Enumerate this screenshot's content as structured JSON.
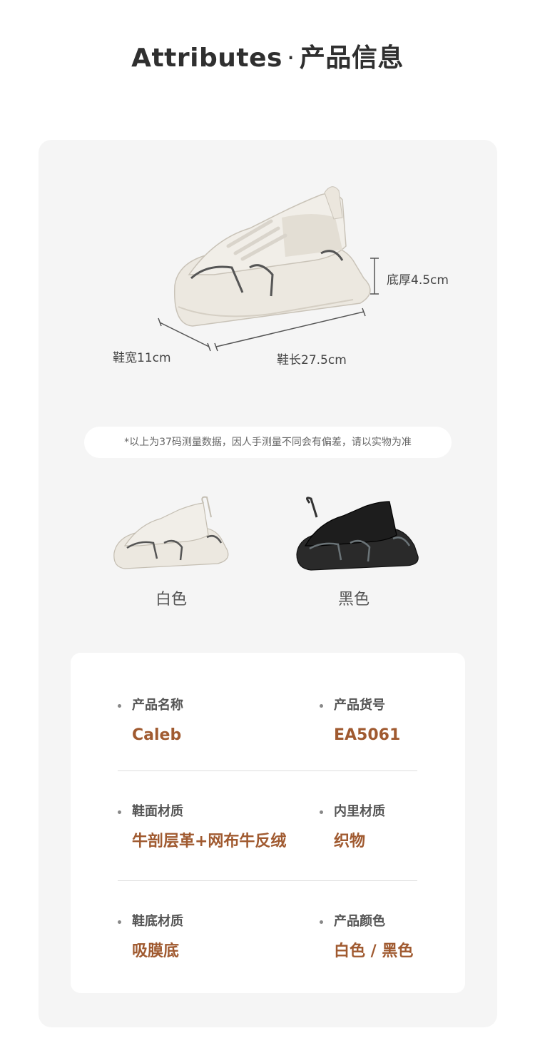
{
  "header": {
    "title_en": "Attributes",
    "separator": "·",
    "title_cn": "产品信息"
  },
  "dimensions": {
    "sole_thickness": "底厚4.5cm",
    "width": "鞋宽11cm",
    "length": "鞋长27.5cm"
  },
  "note": "*以上为37码测量数据，因人手测量不同会有偏差，请以实物为准",
  "variants": [
    {
      "name": "白色",
      "icon": "white-sneaker-icon"
    },
    {
      "name": "黑色",
      "icon": "black-sneaker-icon"
    }
  ],
  "attributes": [
    {
      "label": "产品名称",
      "value": "Caleb"
    },
    {
      "label": "产品货号",
      "value": "EA5061"
    },
    {
      "label": "鞋面材质",
      "value": "牛剖层革+网布牛反绒"
    },
    {
      "label": "内里材质",
      "value": "织物"
    },
    {
      "label": "鞋底材质",
      "value": "吸膜底"
    },
    {
      "label": "产品颜色",
      "value": "白色 / 黑色"
    }
  ],
  "colors": {
    "accent": "#a05a30",
    "panel": "#f5f5f5",
    "card": "#ffffff"
  }
}
